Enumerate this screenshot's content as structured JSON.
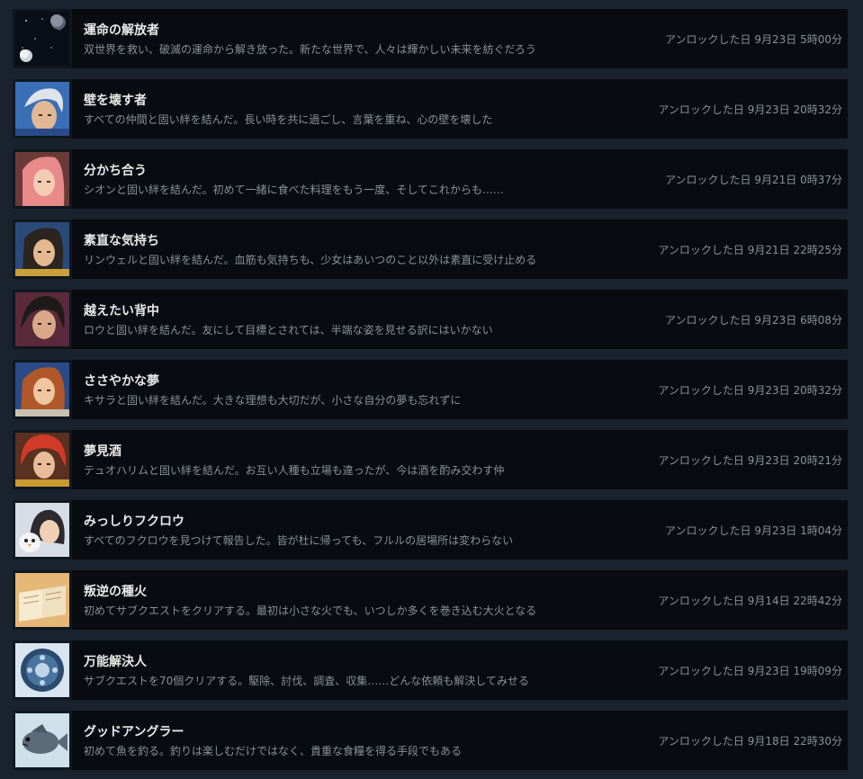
{
  "achievements": [
    {
      "title": "運命の解放者",
      "description": "双世界を救い、破滅の運命から解き放った。新たな世界で、人々は輝かしい未来を紡ぐだろう",
      "unlocked": "アンロックした日 9月23日 5時00分",
      "icon": "space-orbs-icon"
    },
    {
      "title": "壁を壊す者",
      "description": "すべての仲間と固い絆を結んだ。長い時を共に過ごし、言葉を重ね、心の壁を壊した",
      "unlocked": "アンロックした日 9月23日 20時32分",
      "icon": "white-haired-hero-portrait-icon"
    },
    {
      "title": "分かち合う",
      "description": "シオンと固い絆を結んだ。初めて一緒に食べた料理をもう一度、そしてこれからも……",
      "unlocked": "アンロックした日 9月21日 0時37分",
      "icon": "pink-haired-girl-portrait-icon"
    },
    {
      "title": "素直な気持ち",
      "description": "リンウェルと固い絆を結んだ。血筋も気持ちも、少女はあいつのこと以外は素直に受け止める",
      "unlocked": "アンロックした日 9月21日 22時25分",
      "icon": "dark-haired-girl-portrait-icon"
    },
    {
      "title": "越えたい背中",
      "description": "ロウと固い絆を結んだ。友にして目標とされては、半端な姿を見せる訳にはいかない",
      "unlocked": "アンロックした日 9月23日 6時08分",
      "icon": "dark-haired-boy-portrait-icon"
    },
    {
      "title": "ささやかな夢",
      "description": "キサラと固い絆を結んだ。大きな理想も大切だが、小さな自分の夢も忘れずに",
      "unlocked": "アンロックした日 9月23日 20時32分",
      "icon": "auburn-haired-woman-portrait-icon"
    },
    {
      "title": "夢見酒",
      "description": "テュオハリムと固い絆を結んだ。お互い人種も立場も違ったが、今は酒を酌み交わす仲",
      "unlocked": "アンロックした日 9月23日 20時21分",
      "icon": "red-haired-man-portrait-icon"
    },
    {
      "title": "みっしりフクロウ",
      "description": "すべてのフクロウを見つけて報告した。皆が杜に帰っても、フルルの居場所は変わらない",
      "unlocked": "アンロックした日 9月23日 1時04分",
      "icon": "owl-and-girl-portrait-icon"
    },
    {
      "title": "叛逆の種火",
      "description": "初めてサブクエストをクリアする。最初は小さな火でも、いつしか多くを巻き込む大火となる",
      "unlocked": "アンロックした日 9月14日 22時42分",
      "icon": "open-book-icon"
    },
    {
      "title": "万能解決人",
      "description": "サブクエストを70個クリアする。駆除、討伐、調査、収集……どんな依頼も解決してみせる",
      "unlocked": "アンロックした日 9月23日 19時09分",
      "icon": "ornate-emblem-icon"
    },
    {
      "title": "グッドアングラー",
      "description": "初めて魚を釣る。釣りは楽しむだけではなく、貴重な食糧を得る手段でもある",
      "unlocked": "アンロックした日 9月18日 22時30分",
      "icon": "fish-icon"
    }
  ]
}
